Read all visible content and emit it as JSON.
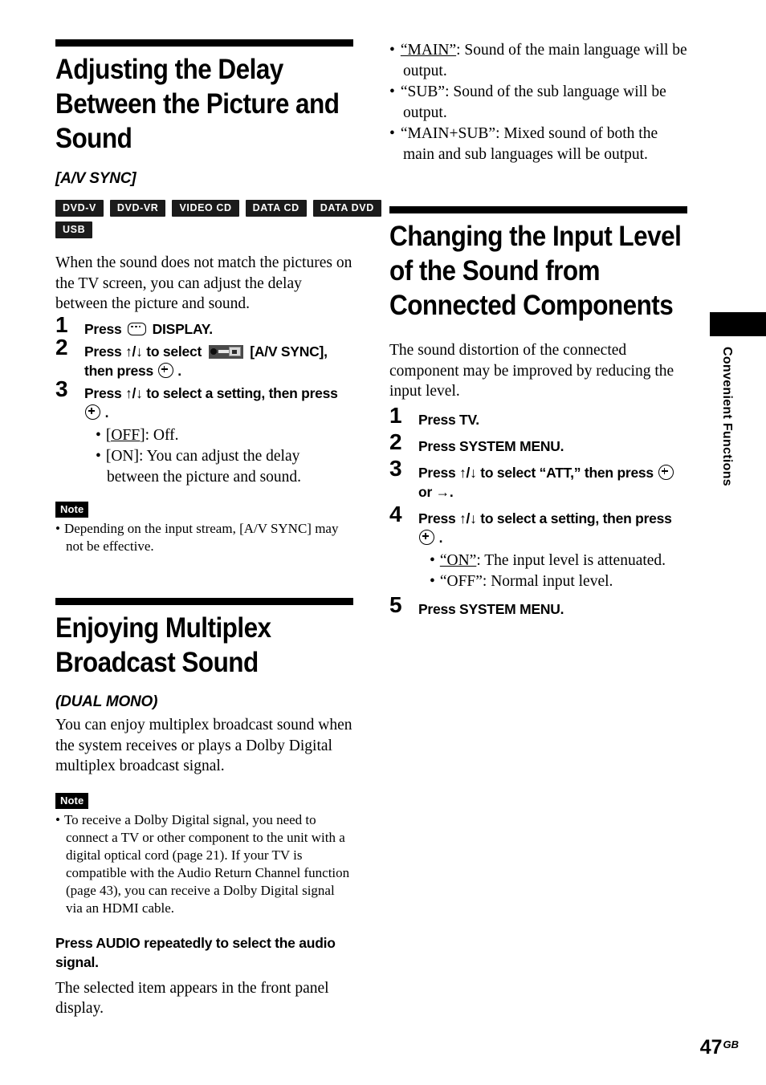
{
  "page": {
    "number": "47",
    "region_code": "GB",
    "side_tab": "Convenient Functions"
  },
  "left_column": {
    "section1": {
      "heading": "Adjusting the Delay Between the Picture and Sound",
      "subtitle": "[A/V SYNC]",
      "badges": [
        [
          "DVD-V",
          "DVD-VR",
          "VIDEO CD",
          "DATA CD",
          "DATA DVD"
        ],
        [
          "USB"
        ]
      ],
      "intro": "When the sound does not match the pictures on the TV screen, you can adjust the delay between the picture and sound.",
      "steps": [
        {
          "number": "1",
          "parts": [
            {
              "type": "text",
              "value": "Press "
            },
            {
              "type": "icon",
              "value": "display-icon"
            },
            {
              "type": "text",
              "value": " DISPLAY."
            }
          ]
        },
        {
          "number": "2",
          "parts": [
            {
              "type": "text",
              "value": "Press "
            },
            {
              "type": "arrows",
              "value": "↑/↓"
            },
            {
              "type": "text",
              "value": " to select "
            },
            {
              "type": "icon",
              "value": "av-sync-icon"
            },
            {
              "type": "text",
              "value": " [A/V SYNC], then press "
            },
            {
              "type": "icon",
              "value": "enter-icon"
            },
            {
              "type": "text",
              "value": " ."
            }
          ]
        },
        {
          "number": "3",
          "parts": [
            {
              "type": "text",
              "value": "Press "
            },
            {
              "type": "arrows",
              "value": "↑/↓"
            },
            {
              "type": "text",
              "value": " to select a setting, then press "
            },
            {
              "type": "icon",
              "value": "enter-icon"
            },
            {
              "type": "text",
              "value": " ."
            }
          ],
          "options": [
            {
              "label": "[OFF]",
              "underlined": true,
              "text": ": Off."
            },
            {
              "label": "[ON]",
              "underlined": false,
              "text": ": You can adjust the delay between the picture and sound."
            }
          ]
        }
      ],
      "note_badge": "Note",
      "notes": [
        "Depending on the input stream, [A/V SYNC] may not be effective."
      ]
    },
    "section2": {
      "heading": "Enjoying Multiplex Broadcast Sound",
      "subtitle": "(DUAL MONO)",
      "intro": "You can enjoy multiplex broadcast sound when the system receives or plays a Dolby Digital multiplex broadcast signal.",
      "note_badge": "Note",
      "notes": [
        "To receive a Dolby Digital signal, you need to connect a TV or other component to the unit with a digital optical cord (page 21). If your TV is compatible with the Audio Return Channel function (page 43), you can receive a Dolby Digital signal via an HDMI cable."
      ],
      "instruction_bold": "Press AUDIO repeatedly to select the audio signal.",
      "instruction_body": "The selected item appears in the front panel display."
    }
  },
  "right_column": {
    "continued_bullets": [
      {
        "quoted": "“MAIN”",
        "underlined": true,
        "text": ": Sound of the main language will be output."
      },
      {
        "quoted": "“SUB”",
        "underlined": false,
        "text": ": Sound of the sub language will be output."
      },
      {
        "quoted": "“MAIN+SUB”",
        "underlined": false,
        "text": ": Mixed sound of both the main and sub languages will be output."
      }
    ],
    "section3": {
      "heading": "Changing the Input Level of the Sound from Connected Components",
      "intro": "The sound distortion of the connected component may be improved by reducing the input level.",
      "steps": [
        {
          "number": "1",
          "parts": [
            {
              "type": "text",
              "value": "Press TV."
            }
          ]
        },
        {
          "number": "2",
          "parts": [
            {
              "type": "text",
              "value": "Press SYSTEM MENU."
            }
          ]
        },
        {
          "number": "3",
          "parts": [
            {
              "type": "text",
              "value": "Press "
            },
            {
              "type": "arrows",
              "value": "↑/↓"
            },
            {
              "type": "text",
              "value": " to select “ATT,” then press "
            },
            {
              "type": "icon",
              "value": "enter-icon"
            },
            {
              "type": "text",
              "value": " or "
            },
            {
              "type": "arrows",
              "value": "→"
            },
            {
              "type": "text",
              "value": "."
            }
          ]
        },
        {
          "number": "4",
          "parts": [
            {
              "type": "text",
              "value": "Press "
            },
            {
              "type": "arrows",
              "value": "↑/↓"
            },
            {
              "type": "text",
              "value": " to select a setting, then press "
            },
            {
              "type": "icon",
              "value": "enter-icon"
            },
            {
              "type": "text",
              "value": " ."
            }
          ],
          "options": [
            {
              "label": "“ON”",
              "underlined": true,
              "text": ": The input level is attenuated."
            },
            {
              "label": "“OFF”",
              "underlined": false,
              "text": ": Normal input level."
            }
          ]
        },
        {
          "number": "5",
          "parts": [
            {
              "type": "text",
              "value": "Press SYSTEM MENU."
            }
          ]
        }
      ]
    }
  }
}
